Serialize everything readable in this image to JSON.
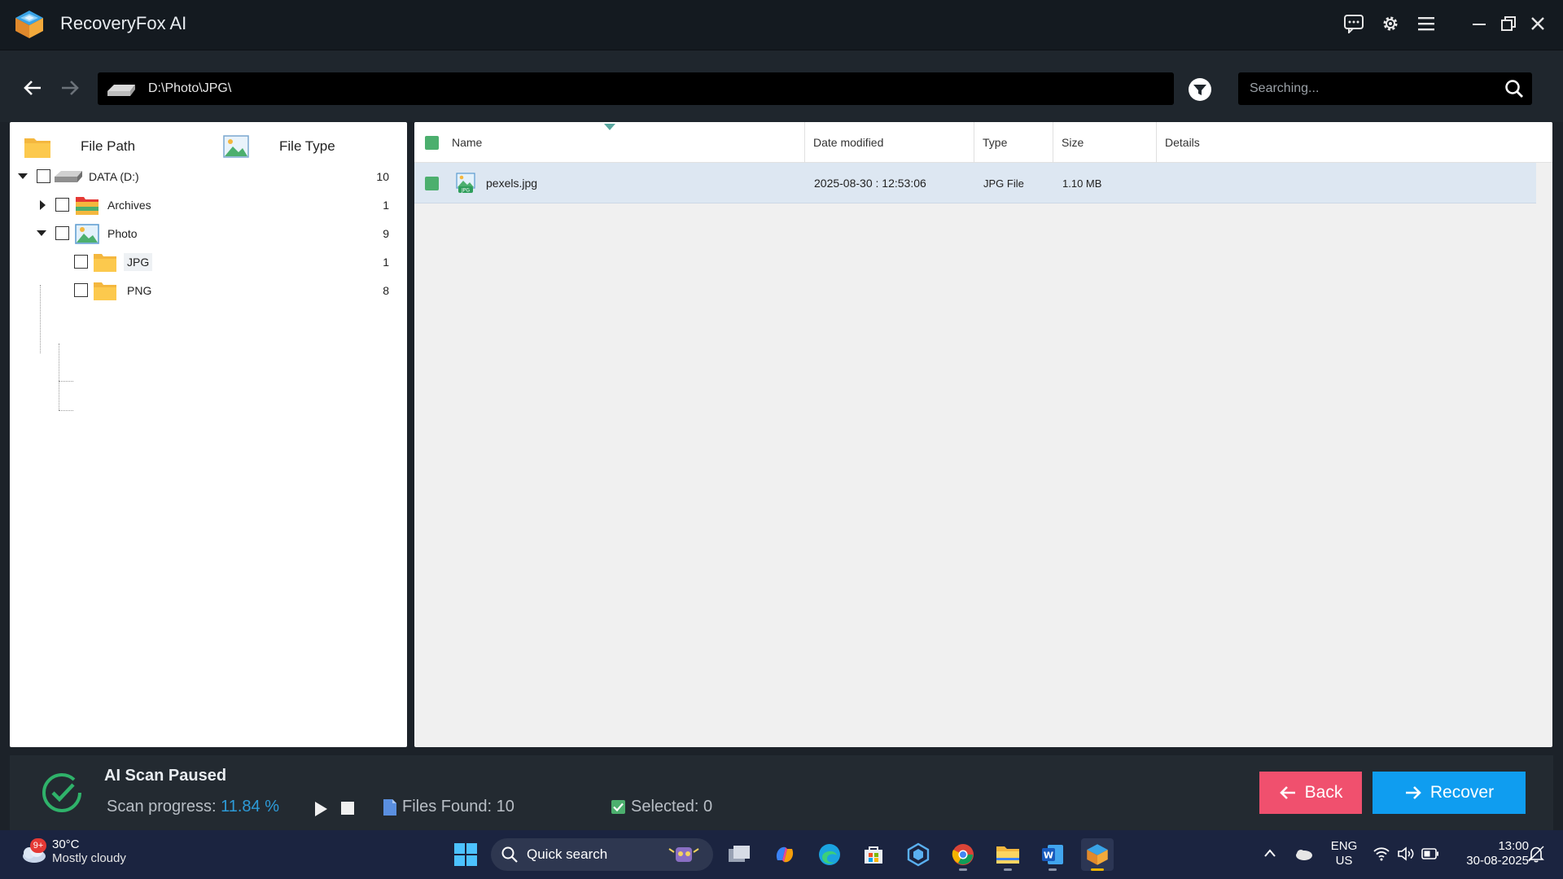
{
  "app": {
    "title": "RecoveryFox AI"
  },
  "toolbar": {
    "path": "D:\\Photo\\JPG\\",
    "search_placeholder": "Searching..."
  },
  "left_panel": {
    "tabs": [
      {
        "label": "File Path"
      },
      {
        "label": "File Type"
      }
    ],
    "tree": [
      {
        "label": "DATA (D:)",
        "count": "10"
      },
      {
        "label": "Archives",
        "count": "1"
      },
      {
        "label": "Photo",
        "count": "9"
      },
      {
        "label": "JPG",
        "count": "1"
      },
      {
        "label": "PNG",
        "count": "8"
      }
    ]
  },
  "table": {
    "columns": [
      "Name",
      "Date modified",
      "Type",
      "Size",
      "Details"
    ],
    "rows": [
      {
        "name": "pexels.jpg",
        "date": "2025-08-30 : 12:53:06",
        "type": "JPG File",
        "size": "1.10 MB",
        "details": ""
      }
    ]
  },
  "status": {
    "title": "AI Scan Paused",
    "progress_label": "Scan progress:",
    "progress_value": "11.84 %",
    "files_found": "Files Found: 10",
    "selected": "Selected: 0"
  },
  "buttons": {
    "back": "Back",
    "recover": "Recover"
  },
  "taskbar": {
    "badge": "9+",
    "temperature": "30°C",
    "condition": "Mostly cloudy",
    "search_label": "Quick search",
    "lang_top": "ENG",
    "lang_bottom": "US",
    "time": "13:00",
    "date": "30-08-2025"
  },
  "colors": {
    "accent_blue": "#0f9df0",
    "back_red": "#f0506e",
    "progress_blue": "#2d9bd8",
    "check_green": "#4caf6e"
  }
}
